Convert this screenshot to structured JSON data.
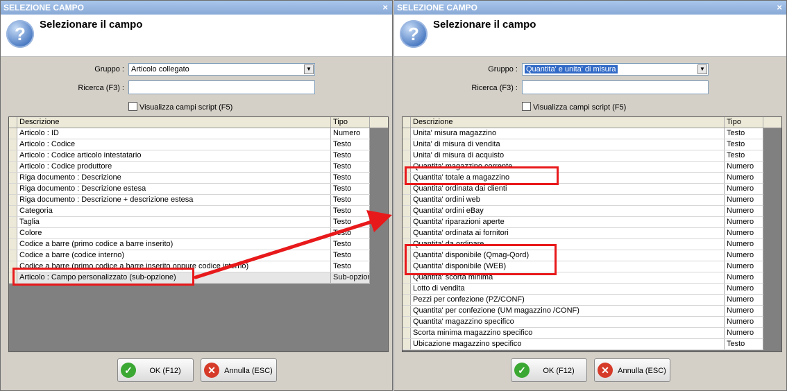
{
  "left": {
    "title": "SELEZIONE CAMPO",
    "close": "×",
    "heading": "Selezionare il campo",
    "gruppo_label": "Gruppo :",
    "gruppo_value": "Articolo collegato",
    "ricerca_label": "Ricerca (F3) :",
    "checkbox_label": "Visualizza campi script (F5)",
    "columns": {
      "desc": "Descrizione",
      "tipo": "Tipo"
    },
    "rows": [
      {
        "desc": "Articolo : ID",
        "tipo": "Numero"
      },
      {
        "desc": "Articolo : Codice",
        "tipo": "Testo"
      },
      {
        "desc": "Articolo : Codice articolo intestatario",
        "tipo": "Testo"
      },
      {
        "desc": "Articolo : Codice produttore",
        "tipo": "Testo"
      },
      {
        "desc": "Riga documento : Descrizione",
        "tipo": "Testo"
      },
      {
        "desc": "Riga documento : Descrizione estesa",
        "tipo": "Testo"
      },
      {
        "desc": "Riga documento : Descrizione + descrizione estesa",
        "tipo": "Testo"
      },
      {
        "desc": "Categoria",
        "tipo": "Testo"
      },
      {
        "desc": "Taglia",
        "tipo": "Testo"
      },
      {
        "desc": "Colore",
        "tipo": "Testo"
      },
      {
        "desc": "Codice a barre (primo codice a barre inserito)",
        "tipo": "Testo"
      },
      {
        "desc": "Codice a barre (codice interno)",
        "tipo": "Testo"
      },
      {
        "desc": "Codice a barre (primo codice a barre inserito oppure codice interno)",
        "tipo": "Testo"
      },
      {
        "desc": "Articolo : Campo personalizzato (sub-opzione)",
        "tipo": "Sub-opzione"
      }
    ],
    "ok_label": "OK (F12)",
    "cancel_label": "Annulla (ESC)"
  },
  "right": {
    "title": "SELEZIONE CAMPO",
    "close": "×",
    "heading": "Selezionare il campo",
    "gruppo_label": "Gruppo :",
    "gruppo_value": "Quantita' e unita' di misura",
    "ricerca_label": "Ricerca (F3) :",
    "checkbox_label": "Visualizza campi script (F5)",
    "columns": {
      "desc": "Descrizione",
      "tipo": "Tipo"
    },
    "rows": [
      {
        "desc": "Unita' misura magazzino",
        "tipo": "Testo"
      },
      {
        "desc": "Unita' di misura di vendita",
        "tipo": "Testo"
      },
      {
        "desc": "Unita' di misura di acquisto",
        "tipo": "Testo"
      },
      {
        "desc": "Quantita' magazzino corrente",
        "tipo": "Numero"
      },
      {
        "desc": "Quantita' totale a magazzino",
        "tipo": "Numero"
      },
      {
        "desc": "Quantita' ordinata dai clienti",
        "tipo": "Numero"
      },
      {
        "desc": "Quantita' ordini web",
        "tipo": "Numero"
      },
      {
        "desc": "Quantita' ordini eBay",
        "tipo": "Numero"
      },
      {
        "desc": "Quantita' riparazioni aperte",
        "tipo": "Numero"
      },
      {
        "desc": "Quantita' ordinata ai fornitori",
        "tipo": "Numero"
      },
      {
        "desc": "Quantita' da ordinare",
        "tipo": "Numero"
      },
      {
        "desc": "Quantita' disponibile (Qmag-Qord)",
        "tipo": "Numero"
      },
      {
        "desc": "Quantita' disponibile (WEB)",
        "tipo": "Numero"
      },
      {
        "desc": "Quantita' scorta minima",
        "tipo": "Numero"
      },
      {
        "desc": "Lotto di vendita",
        "tipo": "Numero"
      },
      {
        "desc": "Pezzi per confezione (PZ/CONF)",
        "tipo": "Numero"
      },
      {
        "desc": "Quantita' per confezione (UM magazzino /CONF)",
        "tipo": "Numero"
      },
      {
        "desc": "Quantita' magazzino specifico",
        "tipo": "Numero"
      },
      {
        "desc": "Scorta minima magazzino specifico",
        "tipo": "Numero"
      },
      {
        "desc": "Ubicazione magazzino specifico",
        "tipo": "Testo"
      }
    ],
    "ok_label": "OK (F12)",
    "cancel_label": "Annulla (ESC)"
  },
  "icons": {
    "question": "?",
    "ok": "✓",
    "cancel": "✕",
    "dropdown": "▼"
  },
  "colors": {
    "highlight": "#e8191b",
    "selection": "#3169c6",
    "ok_green": "#3aa833",
    "cancel_red": "#d63b2a"
  }
}
